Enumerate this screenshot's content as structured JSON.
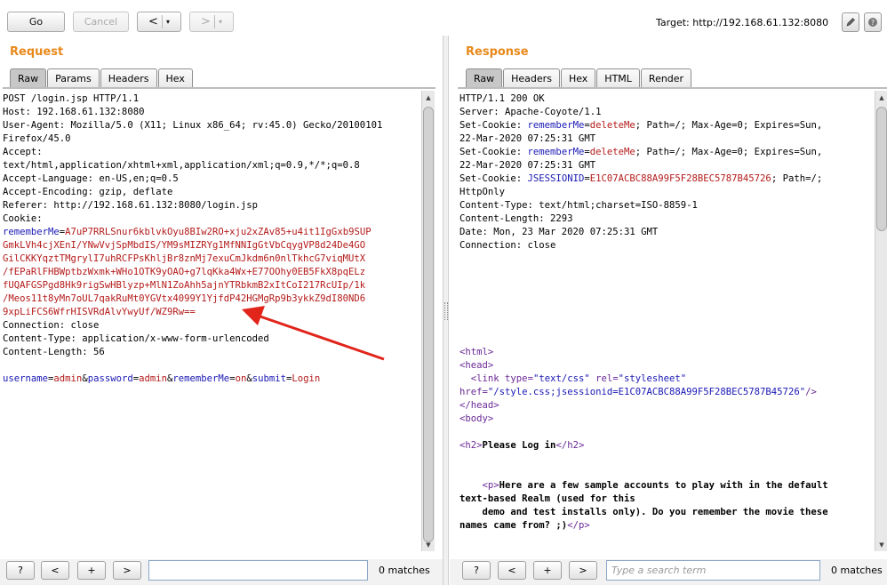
{
  "toolbar": {
    "go": "Go",
    "cancel": "Cancel",
    "back": "<",
    "forward": ">",
    "dropdown": "▾",
    "target_label": "Target: http://192.168.61.132:8080"
  },
  "request": {
    "title": "Request",
    "tabs": [
      "Raw",
      "Params",
      "Headers",
      "Hex"
    ],
    "active_tab": "Raw",
    "lines": [
      [
        {
          "t": "POST /login.jsp HTTP/1.1"
        }
      ],
      [
        {
          "t": "Host: 192.168.61.132:8080"
        }
      ],
      [
        {
          "t": "User-Agent: Mozilla/5.0 (X11; Linux x86_64; rv:45.0) Gecko/20100101"
        }
      ],
      [
        {
          "t": "Firefox/45.0"
        }
      ],
      [
        {
          "t": "Accept:"
        }
      ],
      [
        {
          "t": "text/html,application/xhtml+xml,application/xml;q=0.9,*/*;q=0.8"
        }
      ],
      [
        {
          "t": "Accept-Language: en-US,en;q=0.5"
        }
      ],
      [
        {
          "t": "Accept-Encoding: gzip, deflate"
        }
      ],
      [
        {
          "t": "Referer: http://192.168.61.132:8080/login.jsp"
        }
      ],
      [
        {
          "t": "Cookie:"
        }
      ],
      [
        {
          "t": "rememberMe",
          "c": "k"
        },
        {
          "t": "="
        },
        {
          "t": "A7uP7RRLSnur6kblvkOyu8BIw2RO+xju2xZAv85+u4it1IgGxb9SUP",
          "c": "v"
        }
      ],
      [
        {
          "t": "GmkLVh4cjXEnI/YNwVvjSpMbdIS/YM9sMIZRYg1MfNNIgGtVbCqygVP8d24De4GO",
          "c": "v"
        }
      ],
      [
        {
          "t": "GilCKKYqztTMgrylI7uhRCFPsKhljBr8znMj7exuCmJkdm6n0nlTkhcG7viqMUtX",
          "c": "v"
        }
      ],
      [
        {
          "t": "/fEPaRlFHBWptbzWxmk+WHo1OTK9yOAO+g7lqKka4Wx+E77OOhy0EB5FkX8pqELz",
          "c": "v"
        }
      ],
      [
        {
          "t": "fUQAFGSPgd8Hk9rigSwHBlyzp+MlN1ZoAhh5ajnYTRbkmB2xItCoI217RcUIp/1k",
          "c": "v"
        }
      ],
      [
        {
          "t": "/Meos11t8yMn7oUL7qakRuMt0YGVtx4099Y1YjfdP42HGMgRp9b3ykkZ9dI80ND6",
          "c": "v"
        }
      ],
      [
        {
          "t": "9xpLiFCS6WfrHISVRdAlvYwyUf/WZ9Rw==",
          "c": "v"
        }
      ],
      [
        {
          "t": "Connection: close"
        }
      ],
      [
        {
          "t": "Content-Type: application/x-www-form-urlencoded"
        }
      ],
      [
        {
          "t": "Content-Length: 56"
        }
      ],
      [
        {
          "t": ""
        }
      ],
      [
        {
          "t": "username",
          "c": "k"
        },
        {
          "t": "="
        },
        {
          "t": "admin",
          "c": "v"
        },
        {
          "t": "&"
        },
        {
          "t": "password",
          "c": "k"
        },
        {
          "t": "="
        },
        {
          "t": "admin",
          "c": "v"
        },
        {
          "t": "&"
        },
        {
          "t": "rememberMe",
          "c": "k"
        },
        {
          "t": "="
        },
        {
          "t": "on",
          "c": "v"
        },
        {
          "t": "&"
        },
        {
          "t": "submit",
          "c": "k"
        },
        {
          "t": "="
        },
        {
          "t": "Login",
          "c": "v"
        }
      ]
    ],
    "search": {
      "value": "",
      "placeholder": ""
    },
    "matches": "0 matches"
  },
  "response": {
    "title": "Response",
    "tabs": [
      "Raw",
      "Headers",
      "Hex",
      "HTML",
      "Render"
    ],
    "active_tab": "Raw",
    "lines": [
      [
        {
          "t": "HTTP/1.1 200 OK"
        }
      ],
      [
        {
          "t": "Server: Apache-Coyote/1.1"
        }
      ],
      [
        {
          "t": "Set-Cookie: "
        },
        {
          "t": "rememberMe",
          "c": "k"
        },
        {
          "t": "="
        },
        {
          "t": "deleteMe",
          "c": "v"
        },
        {
          "t": "; Path=/; Max-Age=0; Expires=Sun,"
        }
      ],
      [
        {
          "t": "22-Mar-2020 07:25:31 GMT"
        }
      ],
      [
        {
          "t": "Set-Cookie: "
        },
        {
          "t": "rememberMe",
          "c": "k"
        },
        {
          "t": "="
        },
        {
          "t": "deleteMe",
          "c": "v"
        },
        {
          "t": "; Path=/; Max-Age=0; Expires=Sun,"
        }
      ],
      [
        {
          "t": "22-Mar-2020 07:25:31 GMT"
        }
      ],
      [
        {
          "t": "Set-Cookie: "
        },
        {
          "t": "JSESSIONID",
          "c": "k"
        },
        {
          "t": "="
        },
        {
          "t": "E1C07ACBC88A99F5F28BEC5787B45726",
          "c": "v"
        },
        {
          "t": "; Path=/;"
        }
      ],
      [
        {
          "t": "HttpOnly"
        }
      ],
      [
        {
          "t": "Content-Type: text/html;charset=ISO-8859-1"
        }
      ],
      [
        {
          "t": "Content-Length: 2293"
        }
      ],
      [
        {
          "t": "Date: Mon, 23 Mar 2020 07:25:31 GMT"
        }
      ],
      [
        {
          "t": "Connection: close"
        }
      ],
      [
        {
          "t": ""
        }
      ],
      [
        {
          "t": ""
        }
      ],
      [
        {
          "t": ""
        }
      ],
      [
        {
          "t": ""
        }
      ],
      [
        {
          "t": ""
        }
      ],
      [
        {
          "t": ""
        }
      ],
      [
        {
          "t": ""
        }
      ],
      [
        {
          "t": "<html>",
          "c": "t"
        }
      ],
      [
        {
          "t": "<head>",
          "c": "t"
        }
      ],
      [
        {
          "t": "  "
        },
        {
          "t": "<link ",
          "c": "t"
        },
        {
          "t": "type",
          "c": "t"
        },
        {
          "t": "=",
          "c": "t"
        },
        {
          "t": "\"text/css\"",
          "c": "s"
        },
        {
          "t": " rel",
          "c": "t"
        },
        {
          "t": "=",
          "c": "t"
        },
        {
          "t": "\"stylesheet\"",
          "c": "s"
        }
      ],
      [
        {
          "t": "href",
          "c": "t"
        },
        {
          "t": "=",
          "c": "t"
        },
        {
          "t": "\"/style.css;jsessionid=E1C07ACBC88A99F5F28BEC5787B45726\"",
          "c": "s"
        },
        {
          "t": "/>",
          "c": "t"
        }
      ],
      [
        {
          "t": "</head>",
          "c": "t"
        }
      ],
      [
        {
          "t": "<body>",
          "c": "t"
        }
      ],
      [
        {
          "t": ""
        }
      ],
      [
        {
          "t": "<h2>",
          "c": "t"
        },
        {
          "t": "Please Log in",
          "c": "bold"
        },
        {
          "t": "</h2>",
          "c": "t"
        }
      ],
      [
        {
          "t": ""
        }
      ],
      [
        {
          "t": ""
        }
      ],
      [
        {
          "t": "    "
        },
        {
          "t": "<p>",
          "c": "t"
        },
        {
          "t": "Here are a few sample accounts to play with in the default",
          "c": "bold"
        }
      ],
      [
        {
          "t": "text-based Realm (used for this",
          "c": "bold"
        }
      ],
      [
        {
          "t": "    demo and test installs only). Do you remember the movie these",
          "c": "bold"
        }
      ],
      [
        {
          "t": "names came from? ;)",
          "c": "bold"
        },
        {
          "t": "</p>",
          "c": "t"
        }
      ]
    ],
    "search": {
      "value": "",
      "placeholder": "Type a search term"
    },
    "matches": "0 matches"
  },
  "search_buttons": {
    "help": "?",
    "prev": "<",
    "add": "+",
    "next": ">"
  },
  "icons": {
    "edit": "pencil-icon",
    "help": "help-icon"
  }
}
